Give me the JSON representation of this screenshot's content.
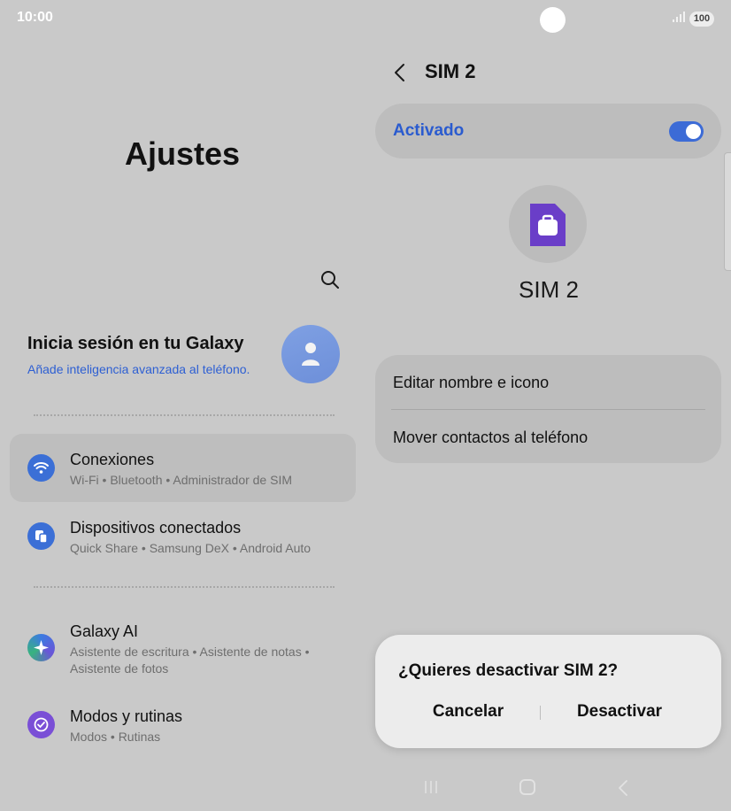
{
  "status_bar": {
    "time": "10:00",
    "signal_icon": "signal-icon",
    "battery": "100"
  },
  "settings": {
    "title": "Ajustes",
    "search_icon": "search-icon",
    "account": {
      "title": "Inicia sesión en tu Galaxy",
      "subtitle": "Añade inteligencia avanzada al teléfono.",
      "avatar_icon": "person-icon"
    },
    "items": [
      {
        "title": "Conexiones",
        "subtitle": "Wi-Fi • Bluetooth • Administrador de SIM",
        "icon": "wifi-icon",
        "color": "#3b6fd6",
        "selected": true
      },
      {
        "title": "Dispositivos conectados",
        "subtitle": "Quick Share • Samsung DeX • Android Auto",
        "icon": "connected-devices-icon",
        "color": "#3b6fd6",
        "selected": false
      },
      {
        "title": "Galaxy AI",
        "subtitle": "Asistente de escritura • Asistente de notas • Asistente de fotos",
        "icon": "galaxy-ai-icon",
        "color": "#4b6fd8",
        "selected": false
      },
      {
        "title": "Modos y rutinas",
        "subtitle": "Modos • Rutinas",
        "icon": "modes-routines-icon",
        "color": "#7a4fd6",
        "selected": false
      }
    ]
  },
  "sim_panel": {
    "header": "SIM 2",
    "back_icon": "back-arrow-icon",
    "toggle_label": "Activado",
    "toggle_on": true,
    "sim_name": "SIM 2",
    "sim_icon_color": "#6a3ec8",
    "options": [
      "Editar nombre e icono",
      "Mover contactos al teléfono"
    ]
  },
  "dialog": {
    "title": "¿Quieres desactivar SIM 2?",
    "cancel_label": "Cancelar",
    "confirm_label": "Desactivar"
  },
  "nav_bar": {
    "recent_icon": "recent-apps-icon",
    "home_icon": "home-icon",
    "back_icon": "nav-back-icon"
  },
  "colors": {
    "accent": "#2a5bcf",
    "background": "#c9c9c9",
    "card": "#bdbdbd"
  }
}
